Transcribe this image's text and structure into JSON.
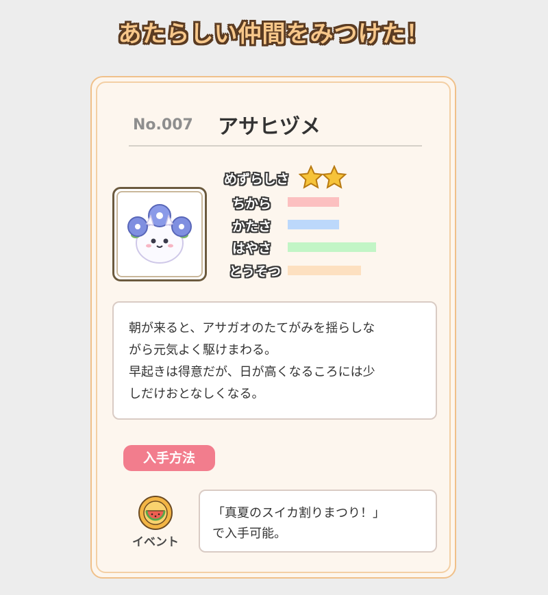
{
  "header": {
    "title": "あたらしい仲間をみつけた！"
  },
  "monster": {
    "number": "No.007",
    "name": "アサヒヅメ",
    "portrait_icon": "morning-glory-fluffball-sprite"
  },
  "stats": {
    "rarity_label": "めずらしさ",
    "rarity_stars": 2,
    "items": [
      {
        "label": "ちから",
        "level": 0.55,
        "color": "#fcc0c0"
      },
      {
        "label": "かたさ",
        "level": 0.55,
        "color": "#bcd8fb"
      },
      {
        "label": "はやさ",
        "level": 0.95,
        "color": "#c2f5c6"
      },
      {
        "label": "とうそつ",
        "level": 0.79,
        "color": "#fde0c0"
      }
    ]
  },
  "description": {
    "lines": [
      "朝が来ると、アサガオのたてがみを揺らしな",
      "がら元気よく駆けまわる。",
      "早起きは得意だが、日が高くなるころには少",
      "しだけおとなしくなる。"
    ]
  },
  "obtain": {
    "tag": "入手方法",
    "source_label": "イベント",
    "source_icon": "watermelon-medal-icon",
    "text_lines": [
      "「真夏のスイカ割りまつり！」",
      "で入手可能。"
    ]
  },
  "colors": {
    "card_border": "#f0c089",
    "card_bg": "#fdf6ee",
    "tag_bg": "#f27d8d",
    "star": "#f6c33a"
  }
}
